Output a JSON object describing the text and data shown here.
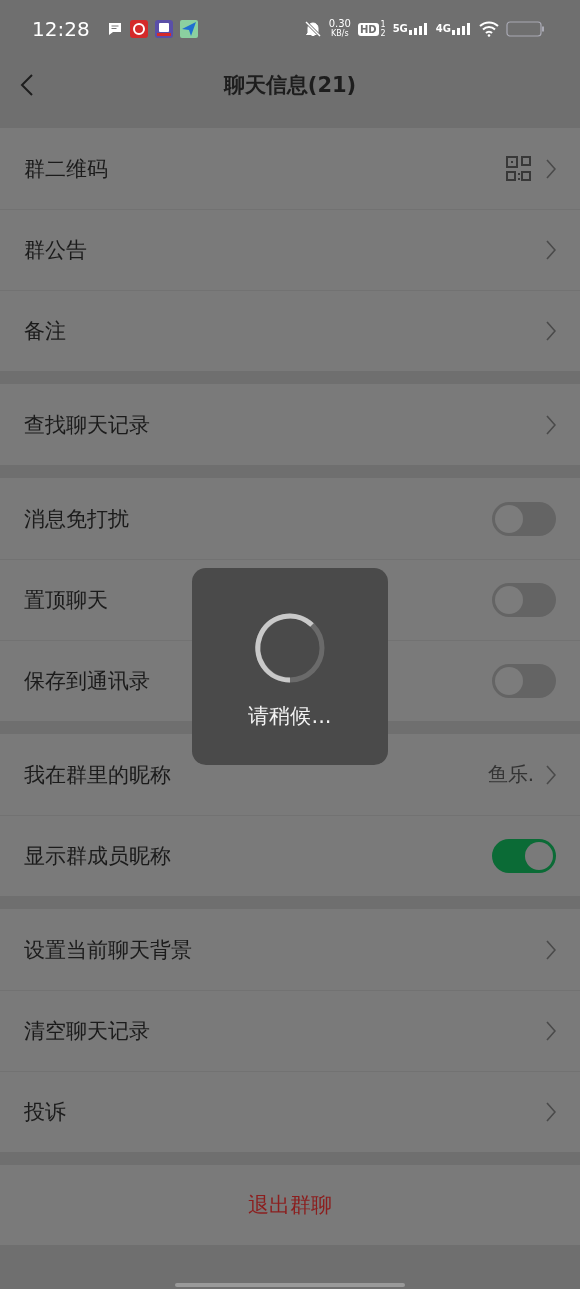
{
  "status_bar": {
    "time": "12:28",
    "net_speed": "0.30",
    "net_unit": "KB/s",
    "hd": "HD",
    "sim_1": "1",
    "sim_2": "2",
    "net_5g": "5G",
    "net_4g": "4G"
  },
  "nav": {
    "title": "聊天信息(21)"
  },
  "groups": [
    {
      "rows": [
        {
          "label": "群二维码",
          "kind": "qr"
        },
        {
          "label": "群公告",
          "kind": "link"
        },
        {
          "label": "备注",
          "kind": "link"
        }
      ]
    },
    {
      "rows": [
        {
          "label": "查找聊天记录",
          "kind": "link"
        }
      ]
    },
    {
      "rows": [
        {
          "label": "消息免打扰",
          "kind": "toggle",
          "on": false
        },
        {
          "label": "置顶聊天",
          "kind": "toggle",
          "on": false
        },
        {
          "label": "保存到通讯录",
          "kind": "toggle",
          "on": false
        }
      ]
    },
    {
      "rows": [
        {
          "label": "我在群里的昵称",
          "kind": "value",
          "value": "鱼乐."
        },
        {
          "label": "显示群成员昵称",
          "kind": "toggle",
          "on": true
        }
      ]
    },
    {
      "rows": [
        {
          "label": "设置当前聊天背景",
          "kind": "link"
        },
        {
          "label": "清空聊天记录",
          "kind": "link"
        },
        {
          "label": "投诉",
          "kind": "link"
        }
      ]
    }
  ],
  "exit_button": "退出群聊",
  "loading": {
    "text": "请稍候..."
  }
}
